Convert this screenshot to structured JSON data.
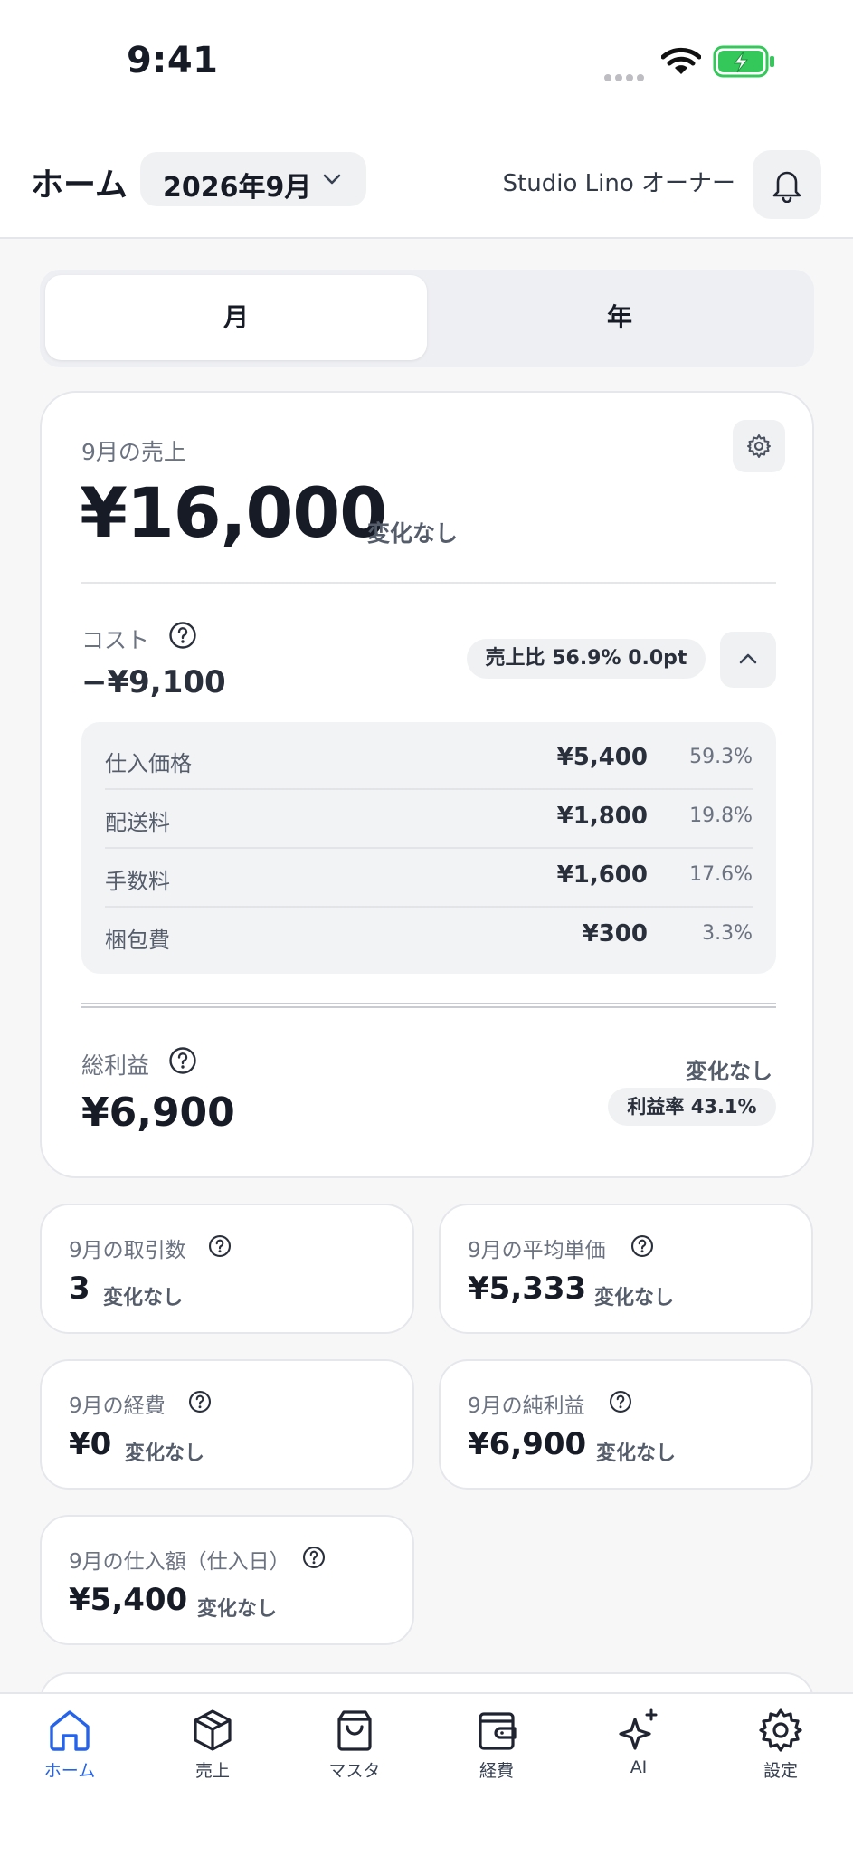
{
  "status_bar": {
    "time": "9:41"
  },
  "header": {
    "title": "ホーム",
    "month": "2026年9月",
    "user": "Studio Lino  オーナー"
  },
  "period_tabs": [
    "月",
    "年"
  ],
  "sales": {
    "label": "9月の売上",
    "value": "¥16,000",
    "change": "変化なし"
  },
  "cost": {
    "label": "コスト",
    "value": "−¥9,100",
    "ratio": "売上比 56.9%  0.0pt",
    "items": [
      {
        "name": "仕入価格",
        "value": "¥5,400",
        "pct": "59.3%"
      },
      {
        "name": "配送料",
        "value": "¥1,800",
        "pct": "19.8%"
      },
      {
        "name": "手数料",
        "value": "¥1,600",
        "pct": "17.6%"
      },
      {
        "name": "梱包費",
        "value": "¥300",
        "pct": "3.3%"
      }
    ]
  },
  "gross_profit": {
    "label": "総利益",
    "value": "¥6,900",
    "change": "変化なし",
    "margin": "利益率 43.1%"
  },
  "stats": [
    {
      "label": "9月の取引数",
      "value": "3",
      "change": "変化なし"
    },
    {
      "label": "9月の平均単価",
      "value": "¥5,333",
      "change": "変化なし"
    },
    {
      "label": "9月の経費",
      "value": "¥0",
      "change": "変化なし"
    },
    {
      "label": "9月の純利益",
      "value": "¥6,900",
      "change": "変化なし"
    },
    {
      "label": "9月の仕入額（仕入日）",
      "value": "¥5,400",
      "change": "変化なし"
    }
  ],
  "tabbar": [
    {
      "label": "ホーム",
      "icon": "home-icon",
      "active": true
    },
    {
      "label": "売上",
      "icon": "box-icon"
    },
    {
      "label": "マスタ",
      "icon": "bag-icon"
    },
    {
      "label": "経費",
      "icon": "wallet-icon"
    },
    {
      "label": "AI",
      "icon": "sparkle-icon"
    },
    {
      "label": "設定",
      "icon": "gear-icon"
    }
  ],
  "colors": {
    "accent": "#2563eb",
    "battery": "#34c759",
    "text": "#161b26"
  }
}
